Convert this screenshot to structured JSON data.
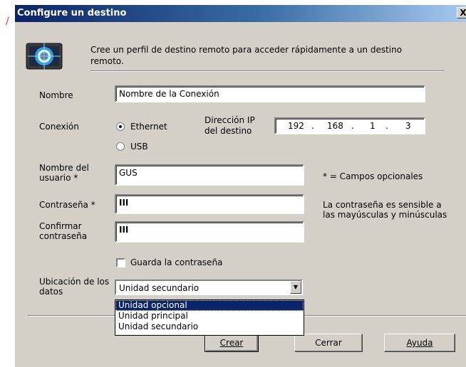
{
  "dialog": {
    "title": "Configure un destino",
    "close_label": "X",
    "intro": "Cree un perfil de destino remoto para acceder rápidamente a un destino remoto.",
    "icon": "target-device-icon"
  },
  "form": {
    "nombre_label": "Nombre",
    "nombre_value": "Nombre de la Conexión",
    "conexion_label": "Conexión",
    "ethernet_label": "Ethernet",
    "usb_label": "USB",
    "connection_selected": "Ethernet",
    "ip_label": "Dirección IP del destino",
    "ip": [
      "192",
      "168",
      "1",
      "3"
    ],
    "ip_dot": ".",
    "usuario_label": "Nombre del usuario *",
    "usuario_value": "GUS",
    "opcionales_note": "* = Campos opcionales",
    "password_label": "Contraseña *",
    "password_value": "III",
    "password_note": "La contraseña es sensible a las mayúsculas y minúsculas",
    "confirm_label": "Confirmar contraseña",
    "confirm_value": "III",
    "save_password_label": "Guarda la contraseña",
    "save_password_checked": false,
    "ubicacion_label": "Ubicación de los datos",
    "ubicacion_value": "Unidad secundario",
    "ubicacion_options": [
      "Unidad opcional",
      "Unidad principal",
      "Unidad secundario"
    ],
    "ubicacion_highlighted": "Unidad opcional"
  },
  "buttons": {
    "crear": "Crear",
    "cerrar": "Cerrar",
    "ayuda": "Ayuda"
  },
  "colors": {
    "title_start": "#0a246a",
    "title_end": "#a6caf0",
    "dialog_bg": "#d4d0c8",
    "highlight": "#0a246a",
    "annotation_red": "#e03020"
  }
}
